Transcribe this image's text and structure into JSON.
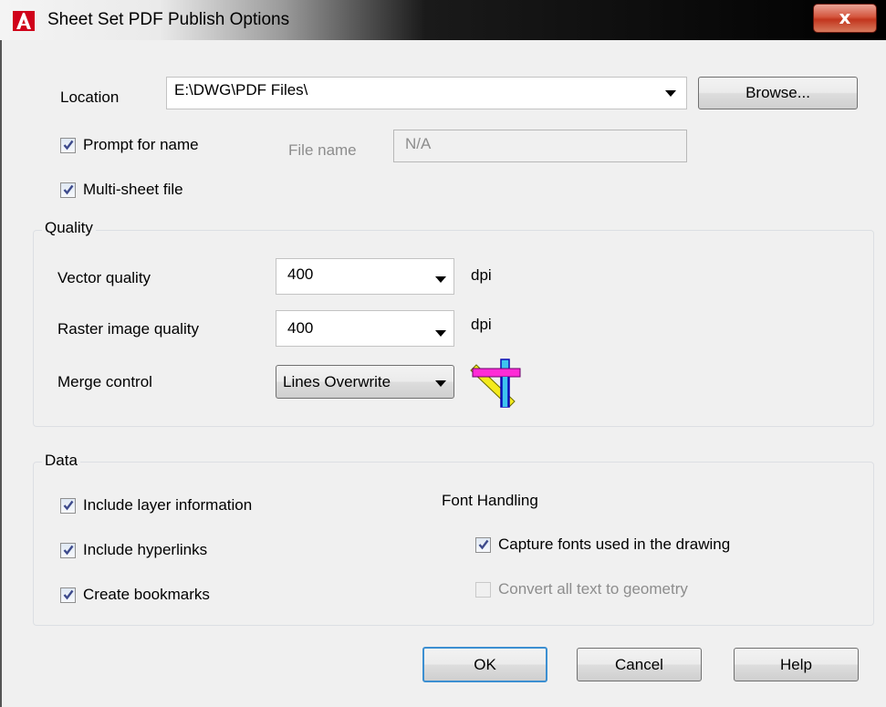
{
  "window": {
    "title": "Sheet Set PDF Publish Options",
    "close_glyph": "x",
    "app_icon": "autocad-logo-icon"
  },
  "location": {
    "label": "Location",
    "value": "E:\\DWG\\PDF Files\\",
    "browse_label": "Browse..."
  },
  "prompt_for_name": {
    "label": "Prompt for name",
    "checked": true
  },
  "file_name": {
    "label": "File name",
    "value": "N/A"
  },
  "multi_sheet": {
    "label": "Multi-sheet file",
    "checked": true
  },
  "quality": {
    "title": "Quality",
    "vector": {
      "label": "Vector quality",
      "value": "400",
      "unit": "dpi"
    },
    "raster": {
      "label": "Raster image quality",
      "value": "400",
      "unit": "dpi"
    },
    "merge": {
      "label": "Merge control",
      "value": "Lines Overwrite",
      "icon": "lines-overwrite-icon"
    }
  },
  "data": {
    "title": "Data",
    "layer_info": {
      "label": "Include layer information",
      "checked": true
    },
    "hyperlinks": {
      "label": "Include hyperlinks",
      "checked": true
    },
    "bookmarks": {
      "label": "Create bookmarks",
      "checked": true
    },
    "font_handling": {
      "title": "Font Handling",
      "capture": {
        "label": "Capture fonts used in the drawing",
        "checked": true
      },
      "convert": {
        "label": "Convert all text to geometry",
        "checked": false,
        "enabled": false
      }
    }
  },
  "buttons": {
    "ok": "OK",
    "cancel": "Cancel",
    "help": "Help"
  },
  "colors": {
    "close_button": "#c2351d",
    "default_button_border": "#3c8fd1",
    "logo_red": "#d0021b"
  }
}
